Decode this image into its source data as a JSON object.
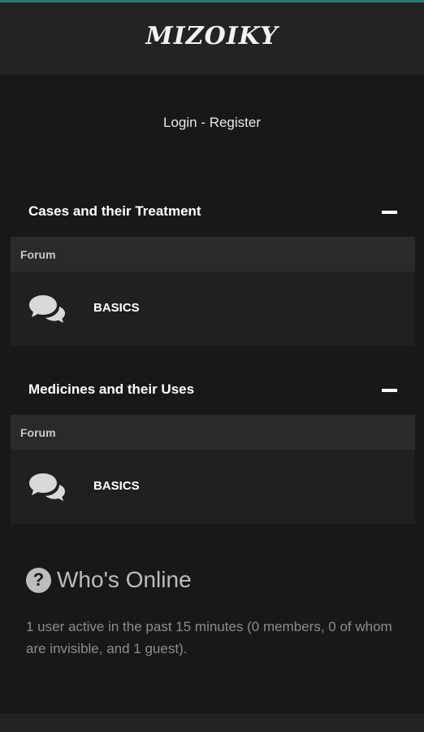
{
  "header": {
    "logo": "MIZOIKY"
  },
  "auth": {
    "login": "Login",
    "separator": " - ",
    "register": "Register"
  },
  "categories": [
    {
      "title": "Cases and their Treatment",
      "column_header": "Forum",
      "forums": [
        {
          "name": "BASICS",
          "icon": "chat-bubbles-icon"
        }
      ]
    },
    {
      "title": "Medicines and their Uses",
      "column_header": "Forum",
      "forums": [
        {
          "name": "BASICS",
          "icon": "chat-bubbles-icon"
        }
      ]
    }
  ],
  "whos_online": {
    "icon": "question-circle-icon",
    "title": "Who's Online",
    "text": "1 user active in the past 15 minutes (0 members, 0 of whom are invisible, and 1 guest)."
  },
  "colors": {
    "accent": "#2b7d6f",
    "background": "#181818",
    "header": "#232323"
  }
}
